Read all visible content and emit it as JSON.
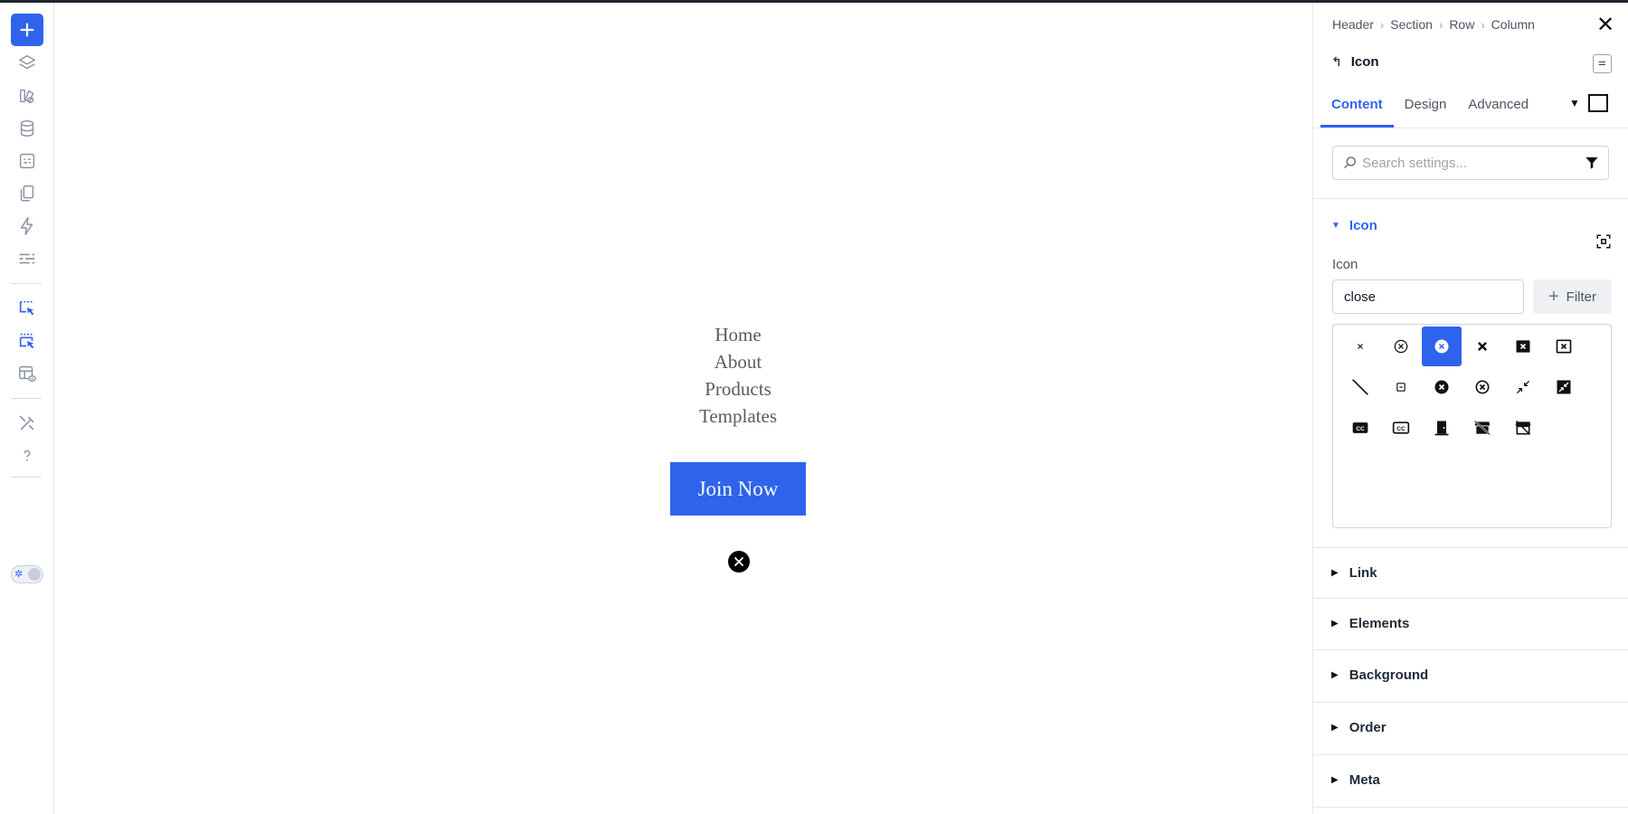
{
  "canvas": {
    "menu": [
      "Home",
      "About",
      "Products",
      "Templates"
    ],
    "cta_label": "Join Now"
  },
  "panel": {
    "breadcrumb": [
      "Header",
      "Section",
      "Row",
      "Column"
    ],
    "element_title": "Icon",
    "tabs": [
      "Content",
      "Design",
      "Advanced"
    ],
    "active_tab": "Content",
    "search_placeholder": "Search settings...",
    "icon_section": {
      "title": "Icon",
      "field_label": "Icon",
      "input_value": "close",
      "filter_label": "Filter",
      "selected_icon": "circle-x-filled-icon"
    },
    "sections": [
      "Link",
      "Elements",
      "Background",
      "Order",
      "Meta"
    ]
  },
  "colors": {
    "accent": "#2f63ee",
    "cta": "#2e64ec",
    "menu_text": "#5b5b5b"
  }
}
